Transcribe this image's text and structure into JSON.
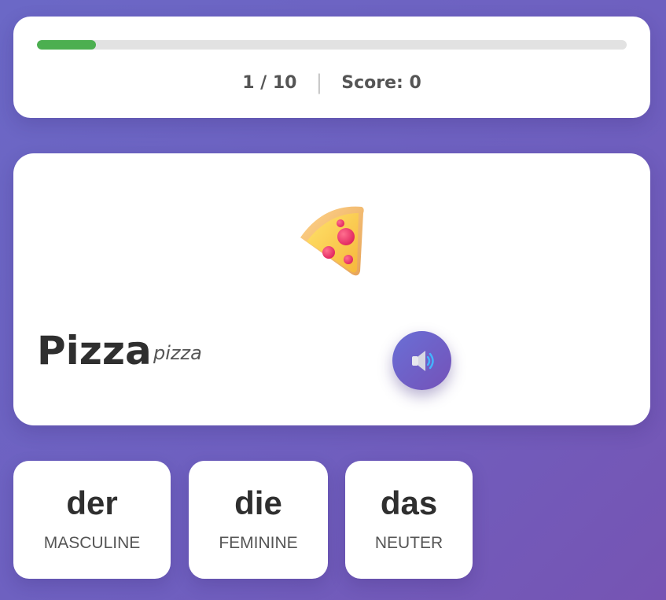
{
  "progress": {
    "fraction": 0.1,
    "counter": "1 / 10",
    "divider": "|",
    "score": "Score: 0",
    "fill_color": "#4caf50"
  },
  "word": {
    "text": "Pizza",
    "translation": "pizza",
    "image_icon": "pizza-slice-icon",
    "audio_icon": "speaker-icon"
  },
  "choices": [
    {
      "article": "der",
      "gender": "MASCULINE"
    },
    {
      "article": "die",
      "gender": "FEMININE"
    },
    {
      "article": "das",
      "gender": "NEUTER"
    }
  ],
  "colors": {
    "background": "#6f5fbf",
    "accent": "#7452b8"
  }
}
